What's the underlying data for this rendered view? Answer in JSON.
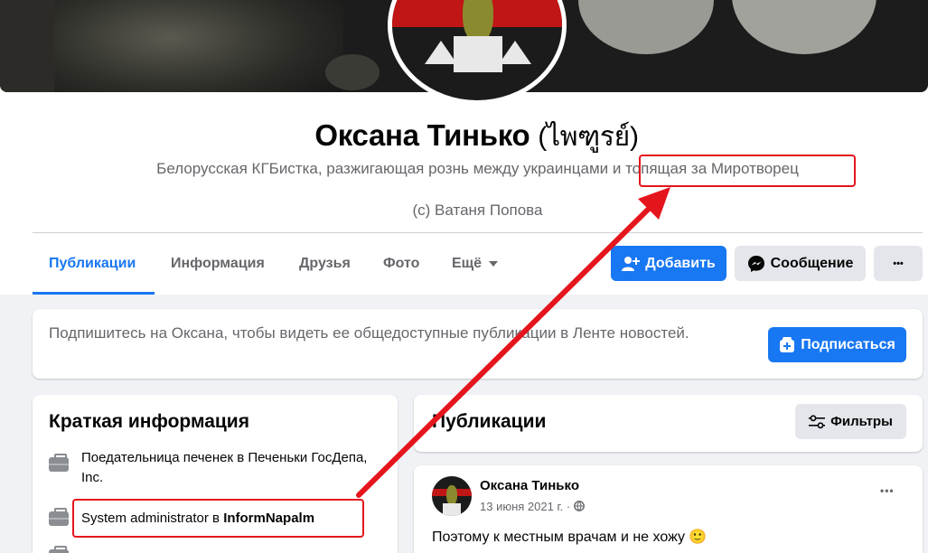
{
  "profile": {
    "name": "Оксана Тинько",
    "alt_name": "(ไพฑูรย์)",
    "bio_line1": "Белорусская КГБистка, разжигающая рознь между украинцами и топящая за Миротворец",
    "bio_line2": "(с) Ватаня Попова"
  },
  "tabs": [
    {
      "label": "Публикации",
      "active": true
    },
    {
      "label": "Информация"
    },
    {
      "label": "Друзья"
    },
    {
      "label": "Фото"
    },
    {
      "label": "Ещё"
    }
  ],
  "actions": {
    "add_label": "Добавить",
    "message_label": "Сообщение",
    "more_label": "•••"
  },
  "subscribe_card": {
    "text": "Подпишитесь на Оксана, чтобы видеть ее общедоступные публикации в Ленте новостей.",
    "button_label": "Подписаться"
  },
  "intro": {
    "title": "Краткая информация",
    "items": [
      {
        "text": "Поедательница печенек в Печеньки ГосДепа, Inc."
      },
      {
        "prefix": "System administrator в ",
        "bold": "InformNapalm"
      }
    ]
  },
  "posts": {
    "title": "Публикации",
    "filter_label": "Фильтры",
    "post": {
      "author": "Оксана Тинько",
      "date": "13 июня 2021 г. ·",
      "text": "Поэтому к местным врачам и не хожу",
      "emoji": "🙂"
    }
  },
  "colors": {
    "accent": "#1877f2",
    "annotation": "#e4151c",
    "background": "#f0f2f5"
  },
  "icons": [
    "add-friend-icon",
    "messenger-icon",
    "subscribe-icon",
    "filter-icon",
    "briefcase-icon",
    "globe-icon",
    "caret-down-icon"
  ]
}
